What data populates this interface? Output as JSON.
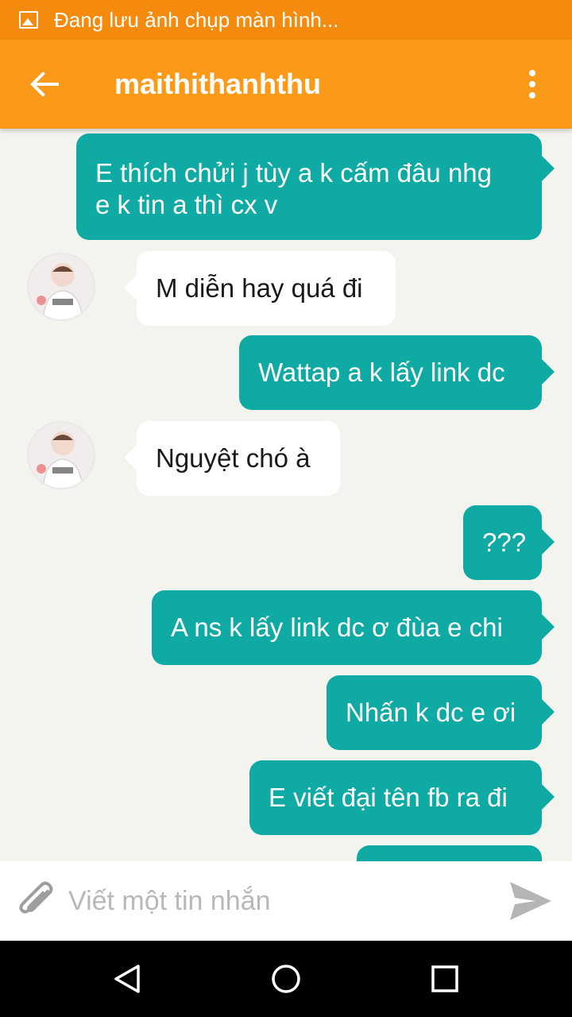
{
  "status_bar": {
    "text": "Đang lưu ảnh chụp màn hình..."
  },
  "app_bar": {
    "title": "maithithanhthu"
  },
  "messages": [
    {
      "direction": "out",
      "text": "E thích chửi j tùy a k cấm đâu nhg\ne k tin a thì cx v"
    },
    {
      "direction": "in",
      "text": "M diễn hay quá đi"
    },
    {
      "direction": "out",
      "text": "Wattap a k lấy link dc"
    },
    {
      "direction": "in",
      "text": "Nguyệt chó à"
    },
    {
      "direction": "out",
      "text": "???"
    },
    {
      "direction": "out",
      "text": "A ns k lấy link dc ơ đùa e chi"
    },
    {
      "direction": "out",
      "text": "Nhấn k dc e ơi"
    },
    {
      "direction": "out",
      "text": "E viết đại tên fb ra đi"
    }
  ],
  "composer": {
    "placeholder": "Viết một tin nhắn"
  },
  "colors": {
    "status_bar": "#f48b0e",
    "app_bar": "#fb9a18",
    "outgoing_bubble": "#0faaa4",
    "incoming_bubble": "#ffffff",
    "chat_background": "#f4f4ef"
  },
  "icons": {
    "status": "image-icon",
    "back": "arrow-left-icon",
    "more": "more-vertical-icon",
    "attach": "paperclip-icon",
    "send": "send-icon",
    "nav_back": "triangle-back-icon",
    "nav_home": "circle-home-icon",
    "nav_recents": "square-recents-icon"
  }
}
